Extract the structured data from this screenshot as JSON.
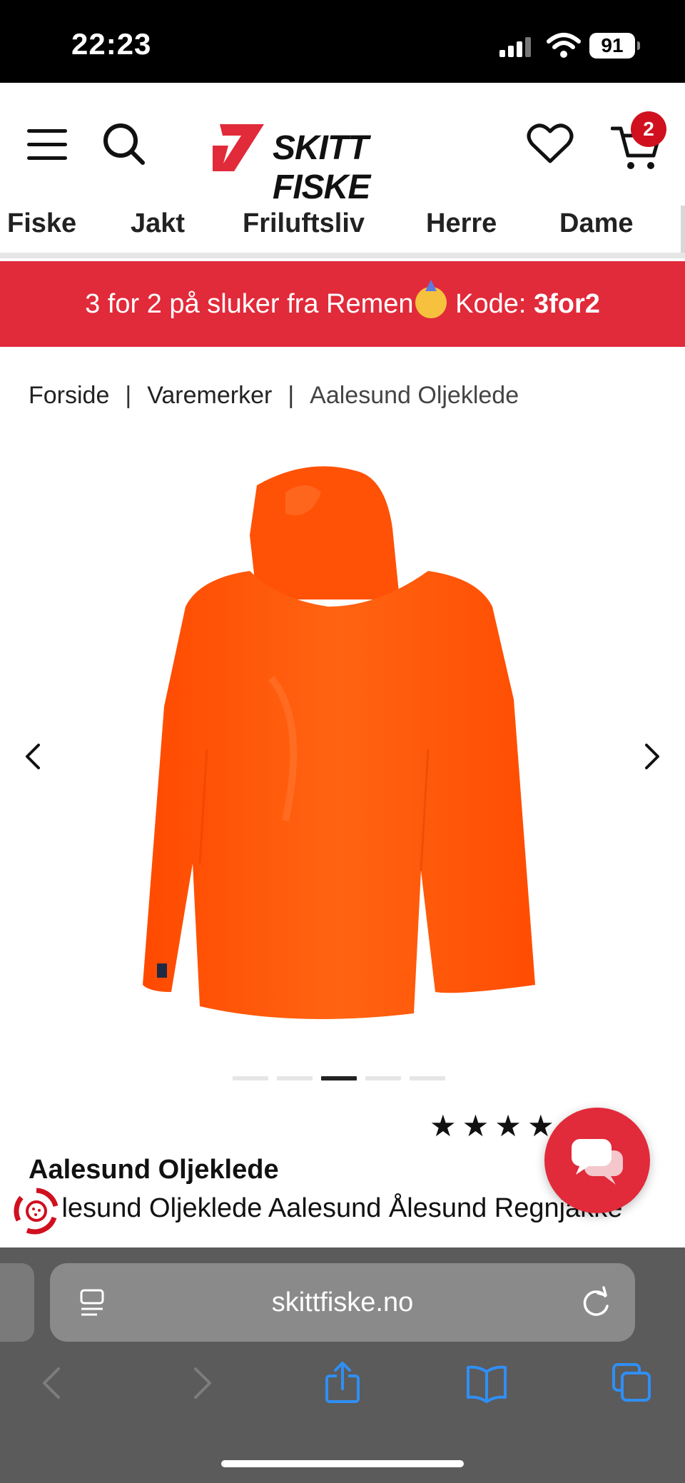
{
  "status_bar": {
    "time": "22:23",
    "battery": "91"
  },
  "header": {
    "brand": "SKITT FISKE",
    "cart_count": "2"
  },
  "nav": {
    "items": [
      "Fiske",
      "Jakt",
      "Friluftsliv",
      "Herre",
      "Dame"
    ]
  },
  "promo": {
    "text": "3 for 2 på sluker fra Remen",
    "code_label": " Kode: ",
    "code": "3for2"
  },
  "breadcrumb": {
    "items": [
      "Forside",
      "Varemerker",
      "Aalesund Oljeklede"
    ],
    "separator": "|"
  },
  "gallery": {
    "active_index": 2,
    "count": 5
  },
  "product": {
    "rating_stars": "★★★★",
    "rating_count": ")",
    "title": "Aalesund Oljeklede",
    "subtitle": "Aalesund Oljeklede Aalesund Ålesund Regnjakke"
  },
  "browser": {
    "url": "skittfiske.no"
  },
  "colors": {
    "brand_red": "#e12a3a",
    "jacket_orange": "#ff5a0a",
    "safari_bg": "#5b5b5b"
  }
}
